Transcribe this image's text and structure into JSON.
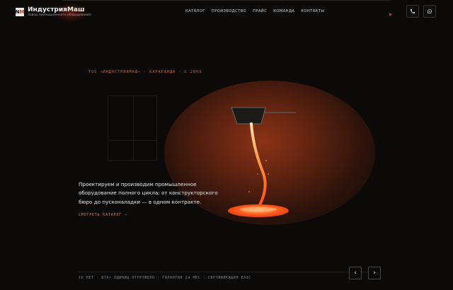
{
  "brand": {
    "mark_letter_1": "N",
    "mark_letter_2": "M",
    "title": "ИндустрияМаш",
    "subtitle": "Завод промышленного оборудования"
  },
  "nav": {
    "items": [
      {
        "label": "КАТАЛОГ"
      },
      {
        "label": "ПРОИЗВОДСТВО"
      },
      {
        "label": "ПРАЙС"
      },
      {
        "label": "КОМАНДА"
      },
      {
        "label": "КОНТАКТЫ"
      }
    ]
  },
  "header_actions": {
    "phone_icon": "phone-icon",
    "whatsapp_icon": "whatsapp-icon"
  },
  "hero": {
    "eyebrow": "ТОО «ИНДУСТРИЯМАШ» · КАРАГАНДА · С 2009",
    "lead": "Проектируем и производим промышленное оборудование полного цикла: от конструкторского бюро до пусконаладки — в одном контракте.",
    "cta": "СМОТРЕТЬ КАТАЛОГ →"
  },
  "footer_strip": {
    "facts": "16 ЛЕТ · 870+ ЕДИНИЦ ОТГРУЖЕНО · ГАРАНТИЯ 24 МЕС · СЕРТИФИКАЦИЯ ЕАЭС"
  },
  "slider": {
    "prev_label": "‹",
    "next_label": "›"
  },
  "colors": {
    "accent": "#e07a47",
    "molten": "#ff6a2a",
    "background": "#0b0a09"
  }
}
